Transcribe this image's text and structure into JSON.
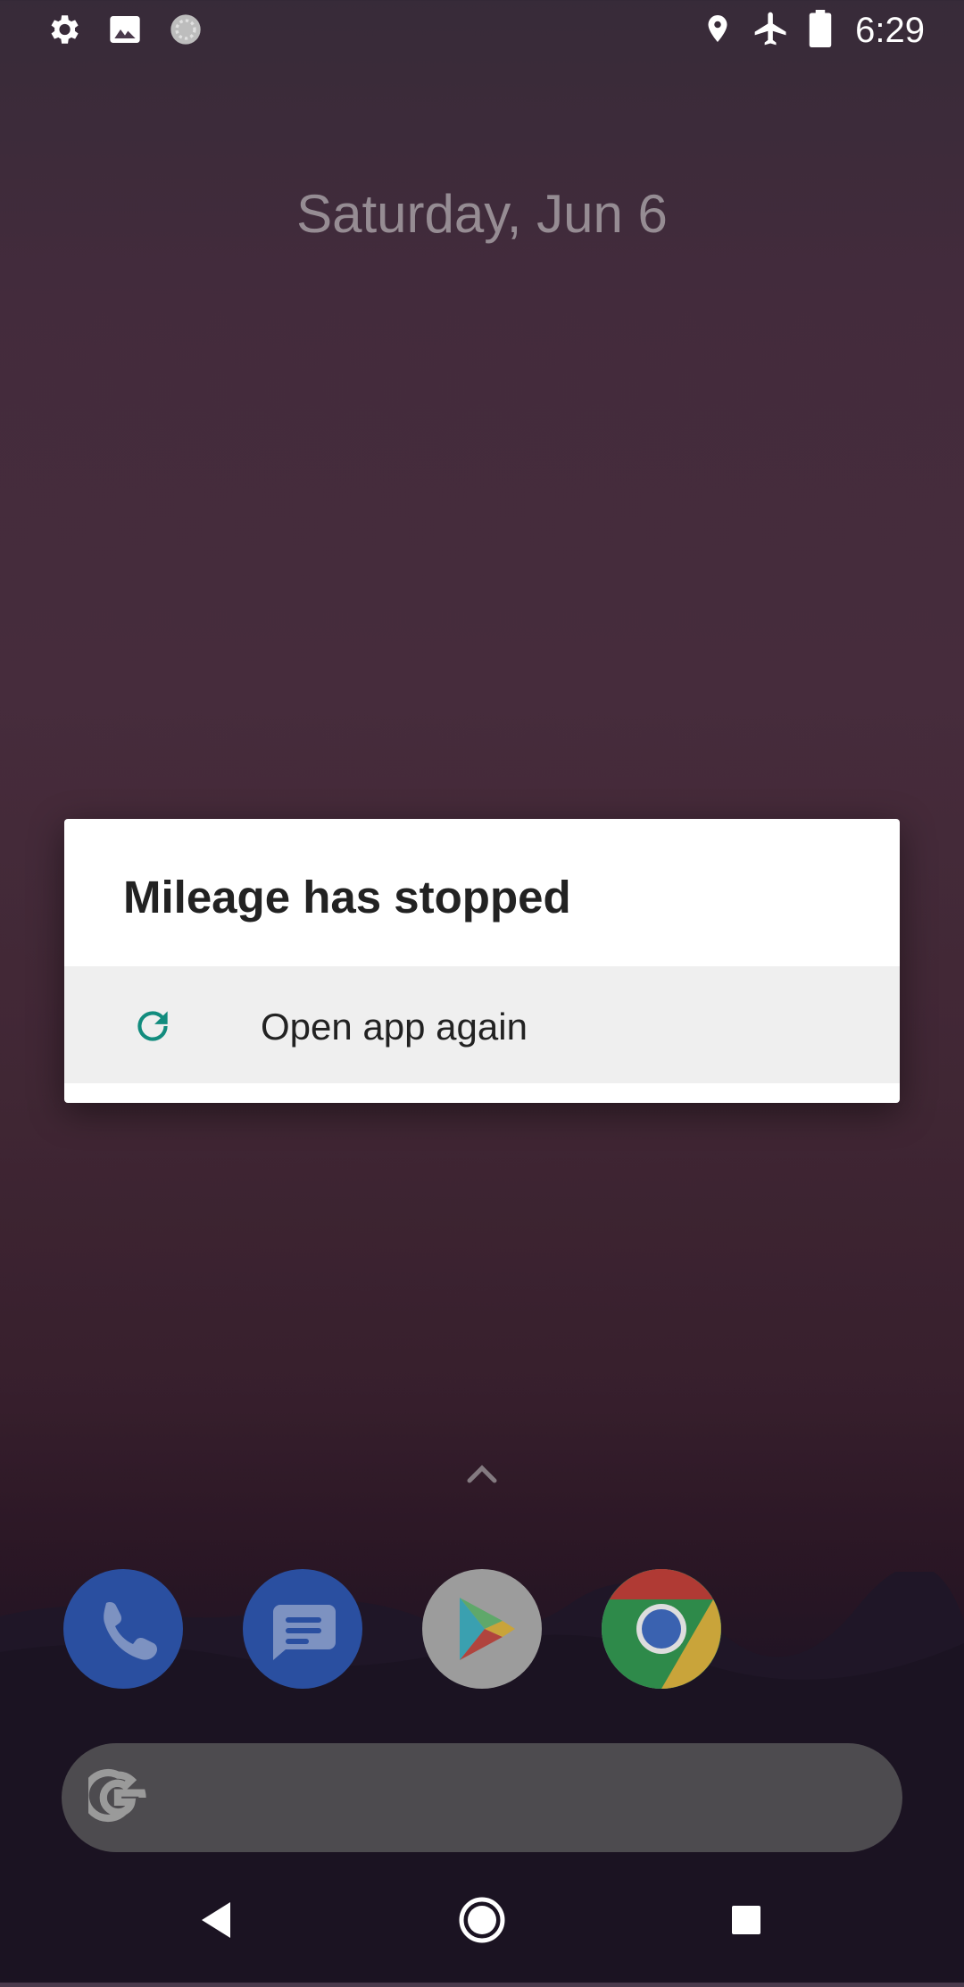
{
  "status_bar": {
    "time": "6:29",
    "left_icons": [
      "gear-icon",
      "image-icon",
      "loading-icon"
    ],
    "right_icons": [
      "location-icon",
      "airplane-icon",
      "battery-icon"
    ]
  },
  "home": {
    "date": "Saturday, Jun 6"
  },
  "dialog": {
    "title": "Mileage has stopped",
    "option_label": "Open app again",
    "accent_color": "#128c7e"
  },
  "dock": {
    "apps": [
      "phone-icon",
      "messages-icon",
      "play-store-icon",
      "chrome-icon"
    ]
  },
  "search": {
    "icon": "google-g-icon"
  },
  "nav": {
    "buttons": [
      "back-button",
      "home-button",
      "recents-button"
    ]
  }
}
